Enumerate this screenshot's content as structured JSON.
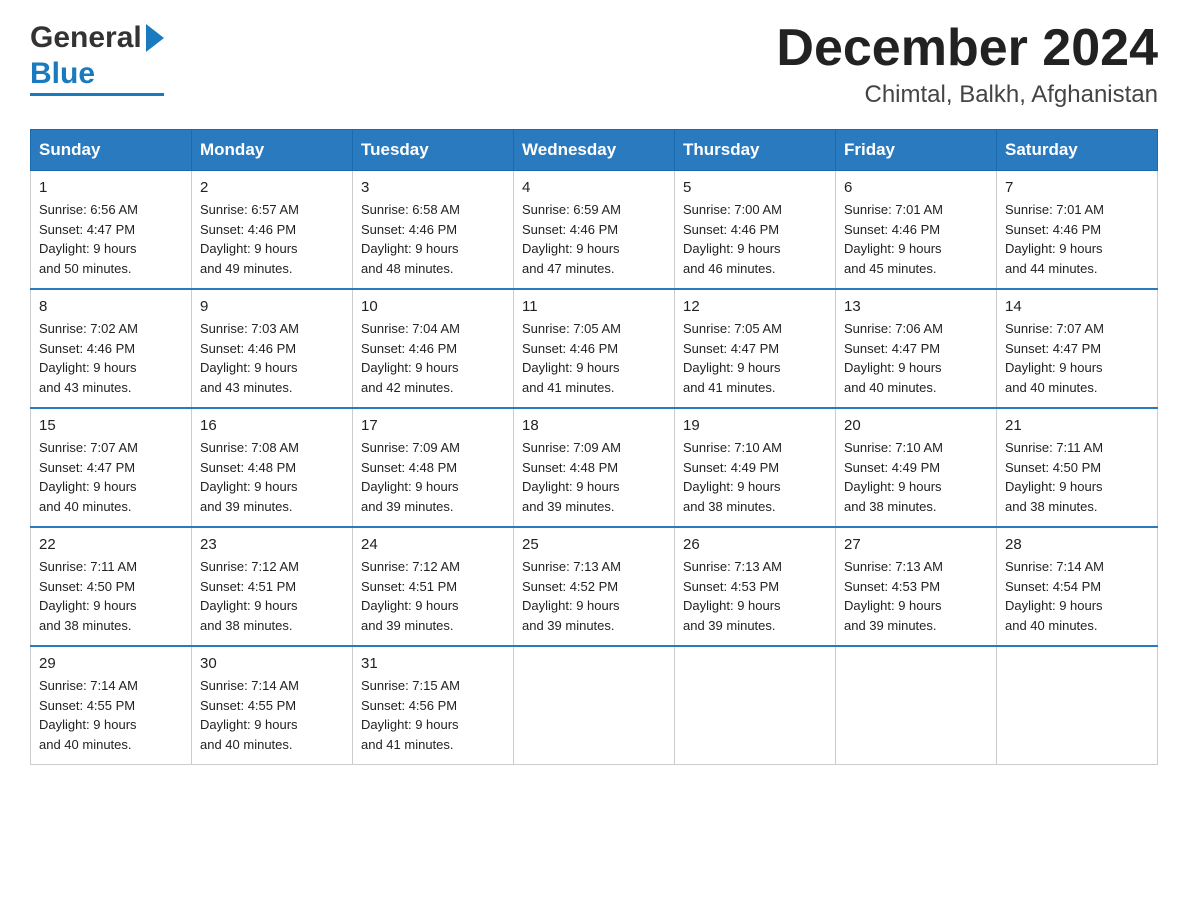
{
  "header": {
    "logo_general": "General",
    "logo_blue": "Blue",
    "month_title": "December 2024",
    "location": "Chimtal, Balkh, Afghanistan"
  },
  "days_of_week": [
    "Sunday",
    "Monday",
    "Tuesday",
    "Wednesday",
    "Thursday",
    "Friday",
    "Saturday"
  ],
  "weeks": [
    [
      {
        "day": "1",
        "sunrise": "6:56 AM",
        "sunset": "4:47 PM",
        "daylight": "9 hours and 50 minutes."
      },
      {
        "day": "2",
        "sunrise": "6:57 AM",
        "sunset": "4:46 PM",
        "daylight": "9 hours and 49 minutes."
      },
      {
        "day": "3",
        "sunrise": "6:58 AM",
        "sunset": "4:46 PM",
        "daylight": "9 hours and 48 minutes."
      },
      {
        "day": "4",
        "sunrise": "6:59 AM",
        "sunset": "4:46 PM",
        "daylight": "9 hours and 47 minutes."
      },
      {
        "day": "5",
        "sunrise": "7:00 AM",
        "sunset": "4:46 PM",
        "daylight": "9 hours and 46 minutes."
      },
      {
        "day": "6",
        "sunrise": "7:01 AM",
        "sunset": "4:46 PM",
        "daylight": "9 hours and 45 minutes."
      },
      {
        "day": "7",
        "sunrise": "7:01 AM",
        "sunset": "4:46 PM",
        "daylight": "9 hours and 44 minutes."
      }
    ],
    [
      {
        "day": "8",
        "sunrise": "7:02 AM",
        "sunset": "4:46 PM",
        "daylight": "9 hours and 43 minutes."
      },
      {
        "day": "9",
        "sunrise": "7:03 AM",
        "sunset": "4:46 PM",
        "daylight": "9 hours and 43 minutes."
      },
      {
        "day": "10",
        "sunrise": "7:04 AM",
        "sunset": "4:46 PM",
        "daylight": "9 hours and 42 minutes."
      },
      {
        "day": "11",
        "sunrise": "7:05 AM",
        "sunset": "4:46 PM",
        "daylight": "9 hours and 41 minutes."
      },
      {
        "day": "12",
        "sunrise": "7:05 AM",
        "sunset": "4:47 PM",
        "daylight": "9 hours and 41 minutes."
      },
      {
        "day": "13",
        "sunrise": "7:06 AM",
        "sunset": "4:47 PM",
        "daylight": "9 hours and 40 minutes."
      },
      {
        "day": "14",
        "sunrise": "7:07 AM",
        "sunset": "4:47 PM",
        "daylight": "9 hours and 40 minutes."
      }
    ],
    [
      {
        "day": "15",
        "sunrise": "7:07 AM",
        "sunset": "4:47 PM",
        "daylight": "9 hours and 40 minutes."
      },
      {
        "day": "16",
        "sunrise": "7:08 AM",
        "sunset": "4:48 PM",
        "daylight": "9 hours and 39 minutes."
      },
      {
        "day": "17",
        "sunrise": "7:09 AM",
        "sunset": "4:48 PM",
        "daylight": "9 hours and 39 minutes."
      },
      {
        "day": "18",
        "sunrise": "7:09 AM",
        "sunset": "4:48 PM",
        "daylight": "9 hours and 39 minutes."
      },
      {
        "day": "19",
        "sunrise": "7:10 AM",
        "sunset": "4:49 PM",
        "daylight": "9 hours and 38 minutes."
      },
      {
        "day": "20",
        "sunrise": "7:10 AM",
        "sunset": "4:49 PM",
        "daylight": "9 hours and 38 minutes."
      },
      {
        "day": "21",
        "sunrise": "7:11 AM",
        "sunset": "4:50 PM",
        "daylight": "9 hours and 38 minutes."
      }
    ],
    [
      {
        "day": "22",
        "sunrise": "7:11 AM",
        "sunset": "4:50 PM",
        "daylight": "9 hours and 38 minutes."
      },
      {
        "day": "23",
        "sunrise": "7:12 AM",
        "sunset": "4:51 PM",
        "daylight": "9 hours and 38 minutes."
      },
      {
        "day": "24",
        "sunrise": "7:12 AM",
        "sunset": "4:51 PM",
        "daylight": "9 hours and 39 minutes."
      },
      {
        "day": "25",
        "sunrise": "7:13 AM",
        "sunset": "4:52 PM",
        "daylight": "9 hours and 39 minutes."
      },
      {
        "day": "26",
        "sunrise": "7:13 AM",
        "sunset": "4:53 PM",
        "daylight": "9 hours and 39 minutes."
      },
      {
        "day": "27",
        "sunrise": "7:13 AM",
        "sunset": "4:53 PM",
        "daylight": "9 hours and 39 minutes."
      },
      {
        "day": "28",
        "sunrise": "7:14 AM",
        "sunset": "4:54 PM",
        "daylight": "9 hours and 40 minutes."
      }
    ],
    [
      {
        "day": "29",
        "sunrise": "7:14 AM",
        "sunset": "4:55 PM",
        "daylight": "9 hours and 40 minutes."
      },
      {
        "day": "30",
        "sunrise": "7:14 AM",
        "sunset": "4:55 PM",
        "daylight": "9 hours and 40 minutes."
      },
      {
        "day": "31",
        "sunrise": "7:15 AM",
        "sunset": "4:56 PM",
        "daylight": "9 hours and 41 minutes."
      },
      null,
      null,
      null,
      null
    ]
  ],
  "labels": {
    "sunrise_prefix": "Sunrise: ",
    "sunset_prefix": "Sunset: ",
    "daylight_prefix": "Daylight: "
  }
}
